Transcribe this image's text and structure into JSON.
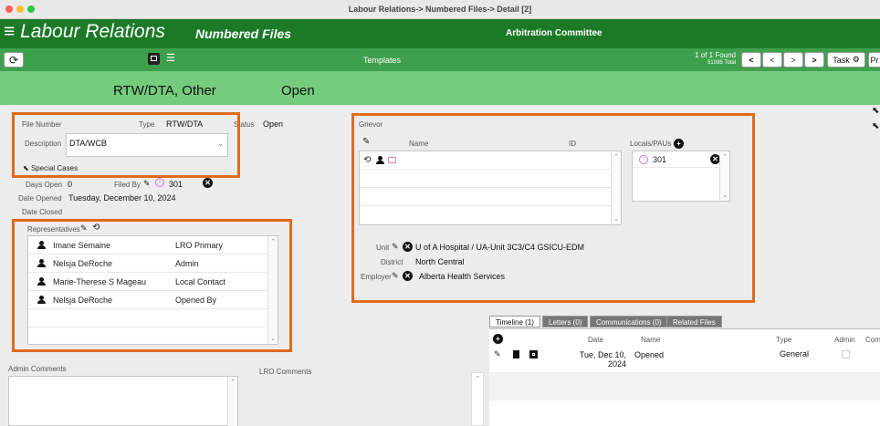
{
  "window": {
    "title": "Labour Relations-> Numbered Files-> Detail [2]"
  },
  "header": {
    "app_title": "Labour Relations",
    "module": "Numbered Files",
    "committee": "Arbitration Committee"
  },
  "toolbar": {
    "templates": "Templates",
    "found_line1": "1 of 1 Found",
    "found_line2": "51095 Total",
    "task_label": "Task",
    "pr_label": "Pr"
  },
  "band": {
    "file_type": "RTW/DTA, Other",
    "status": "Open"
  },
  "file": {
    "number_label": "File Number",
    "type_label": "Type",
    "type_value": "RTW/DTA",
    "status_label": "Status",
    "status_value": "Open",
    "description_label": "Description",
    "description_value": "DTA/WCB",
    "special_cases": "Special Cases",
    "days_open_label": "Days Open",
    "days_open_value": "0",
    "filed_by_label": "Filed By",
    "filed_by_value": "301",
    "date_opened_label": "Date Opened",
    "date_opened_value": "Tuesday, December 10, 2024",
    "date_closed_label": "Date Closed"
  },
  "representatives": {
    "label": "Representatives",
    "rows": [
      {
        "name": "Imane Semaine",
        "role": "LRO Primary"
      },
      {
        "name": "Nelsja DeRoche",
        "role": "Admin"
      },
      {
        "name": "Marie-Therese S Mageau",
        "role": "Local Contact"
      },
      {
        "name": "Nelsja DeRoche",
        "role": "Opened By"
      }
    ]
  },
  "comments": {
    "admin_label": "Admin Comments",
    "lro_label": "LRO Comments"
  },
  "grievor": {
    "label": "Grievor",
    "name_header": "Name",
    "id_header": "ID",
    "locals_label": "Locals/PAUs",
    "local_value": "301",
    "unit_label": "Unit",
    "unit_value": "U of A Hospital / UA-Unit 3C3/C4 GSICU-EDM",
    "district_label": "District",
    "district_value": "North Central",
    "employer_label": "Employer",
    "employer_value": "Alberta Health Services"
  },
  "tabs": [
    "Timeline (1)",
    "Letters (0)",
    "Communications (0)",
    "Related Files"
  ],
  "timeline": {
    "headers": {
      "date": "Date",
      "name": "Name",
      "type": "Type",
      "admin": "Admin",
      "comments": "Com"
    },
    "row": {
      "date_line1": "Tue, Dec 10,",
      "date_line2": "2024",
      "name": "Opened",
      "type": "General"
    }
  },
  "colors": {
    "header_green": "#1c7a27",
    "toolbar_green": "#3ea04c",
    "band_green": "#75cc7d",
    "highlight_orange": "#e06a1c"
  }
}
